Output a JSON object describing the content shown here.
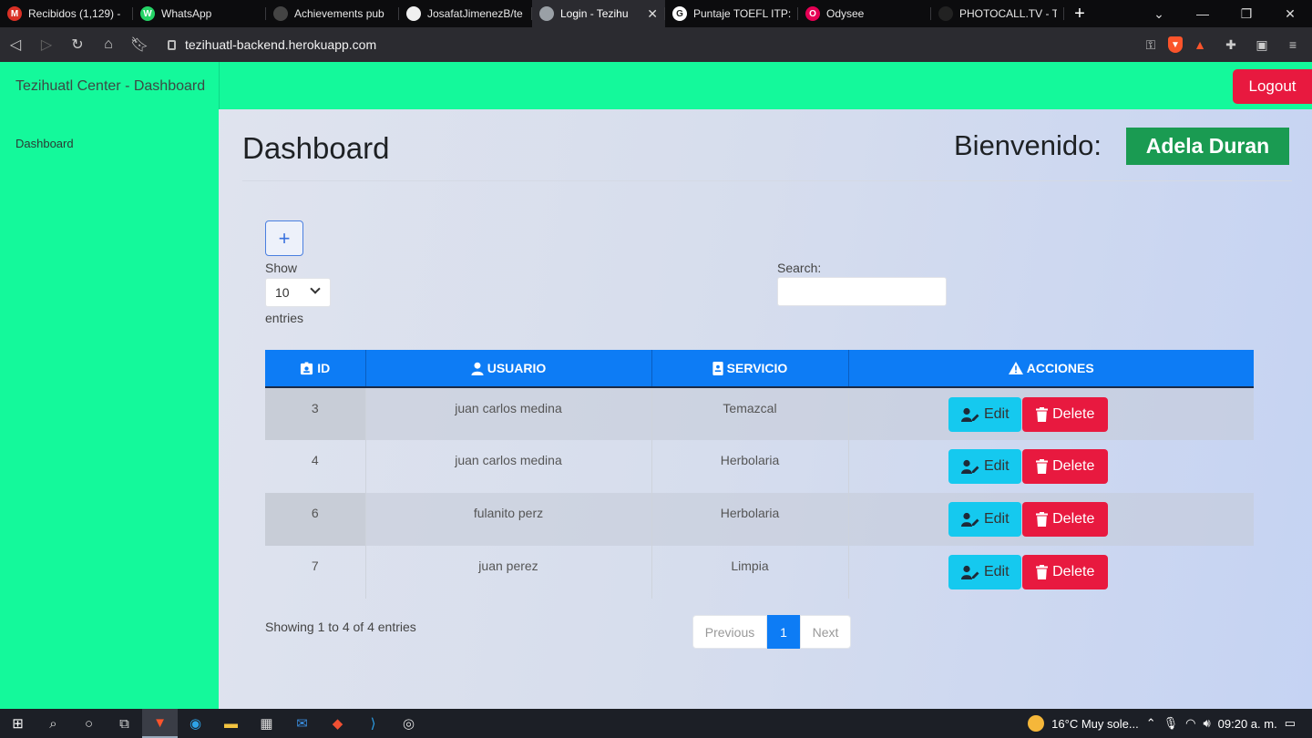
{
  "browser": {
    "tabs": [
      {
        "title": "Recibidos (1,129) -",
        "icon": "gmail-icon",
        "color": "#d93025",
        "glyph": "M",
        "active": false
      },
      {
        "title": "WhatsApp",
        "icon": "whatsapp-icon",
        "color": "#25d366",
        "glyph": "W",
        "active": false
      },
      {
        "title": "Achievements pub",
        "icon": "blank-icon",
        "color": "#444",
        "glyph": "",
        "active": false
      },
      {
        "title": "JosafatJimenezB/te",
        "icon": "github-icon",
        "color": "#f0f0f0",
        "glyph": "",
        "active": false
      },
      {
        "title": "Login - Tezihu",
        "icon": "globe-icon",
        "color": "#9aa0a6",
        "glyph": "",
        "active": true
      },
      {
        "title": "Puntaje TOEFL ITP:",
        "icon": "google-icon",
        "color": "#ffffff",
        "glyph": "G",
        "active": false
      },
      {
        "title": "Odysee",
        "icon": "odysee-icon",
        "color": "#e50054",
        "glyph": "O",
        "active": false
      },
      {
        "title": "PHOTOCALL.TV - T",
        "icon": "photocall-icon",
        "color": "#222",
        "glyph": "",
        "active": false
      }
    ],
    "close_glyph": "✕",
    "new_tab_glyph": "+",
    "url": "tezihuatl-backend.herokuapp.com"
  },
  "navbar": {
    "brand": "Tezihuatl Center - Dashboard",
    "logout_label": "Logout"
  },
  "sidebar": {
    "items": [
      {
        "label": "Dashboard"
      }
    ]
  },
  "main": {
    "title": "Dashboard",
    "welcome_label": "Bienvenido:",
    "username": "Adela Duran",
    "add_glyph": "+",
    "show_label": "Show",
    "page_length": "10",
    "entries_label": "entries",
    "search_label": "Search:",
    "search_value": ""
  },
  "table": {
    "columns": [
      {
        "label": "ID",
        "icon": "id-badge-icon"
      },
      {
        "label": "USUARIO",
        "icon": "user-icon"
      },
      {
        "label": "SERVICIO",
        "icon": "id-card-icon"
      },
      {
        "label": "ACCIONES",
        "icon": "warning-icon"
      }
    ],
    "rows": [
      {
        "id": "3",
        "usuario": "juan carlos medina",
        "servicio": "Temazcal"
      },
      {
        "id": "4",
        "usuario": "juan carlos medina",
        "servicio": "Herbolaria"
      },
      {
        "id": "6",
        "usuario": "fulanito perz",
        "servicio": "Herbolaria"
      },
      {
        "id": "7",
        "usuario": "juan perez",
        "servicio": "Limpia"
      }
    ],
    "edit_label": "Edit",
    "delete_label": "Delete"
  },
  "footer": {
    "info": "Showing 1 to 4 of 4 entries",
    "previous_label": "Previous",
    "current_page": "1",
    "next_label": "Next"
  },
  "taskbar": {
    "weather": "16°C  Muy sole...",
    "clock": "09:20 a. m."
  },
  "colors": {
    "accent_green": "#14f99b",
    "primary_blue": "#0d7cf5",
    "danger_red": "#e8193f",
    "info_cyan": "#15c9ef",
    "success_green": "#1a9b52"
  }
}
